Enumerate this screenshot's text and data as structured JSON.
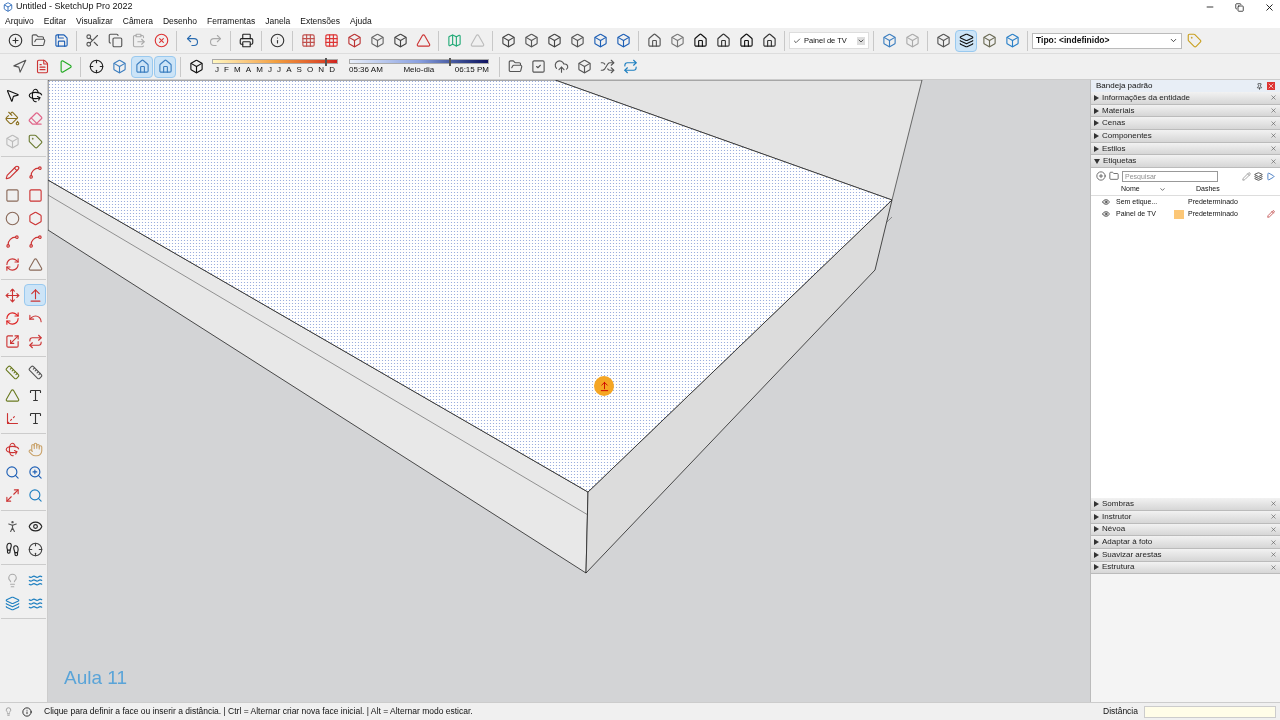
{
  "window": {
    "title": "Untitled - SketchUp Pro 2022"
  },
  "menu": [
    "Arquivo",
    "Editar",
    "Visualizar",
    "Câmera",
    "Desenho",
    "Ferramentas",
    "Janela",
    "Extensões",
    "Ajuda"
  ],
  "tag_dropdown": {
    "value": "Painel de TV",
    "checked": true
  },
  "style_buttons": [
    {
      "selected": false
    },
    {
      "selected": false
    },
    {
      "selected": false
    },
    {
      "selected": true
    },
    {
      "selected": false
    }
  ],
  "type_dropdown": {
    "value": "Tipo: <indefinido>"
  },
  "camera_buttons": [
    {
      "selected": false
    },
    {
      "selected": false
    },
    {
      "selected": true
    },
    {
      "selected": true
    }
  ],
  "shadow_date": {
    "months": [
      "J",
      "F",
      "M",
      "A",
      "M",
      "J",
      "J",
      "A",
      "S",
      "O",
      "N",
      "D"
    ],
    "level": 0.9
  },
  "shadow_time": {
    "start": "05:36 AM",
    "middle": "Meio-dia",
    "end": "06:15 PM",
    "level": 0.72
  },
  "left_tools": [
    {
      "selected": false
    },
    {
      "selected": false
    },
    {
      "selected": false
    },
    {
      "selected": false
    },
    {
      "selected": false
    },
    {
      "selected": false
    },
    {
      "selected": false
    },
    {
      "selected": false
    },
    {
      "selected": false
    },
    {
      "selected": false
    },
    {
      "selected": false
    },
    {
      "selected": false
    },
    {
      "selected": false
    },
    {
      "selected": false
    },
    {
      "selected": false
    },
    {
      "selected": false
    },
    {
      "selected": false
    },
    {
      "selected": true
    },
    {
      "selected": false
    },
    {
      "selected": false
    },
    {
      "selected": false
    },
    {
      "selected": false
    },
    {
      "selected": false
    },
    {
      "selected": false
    },
    {
      "selected": false
    },
    {
      "selected": false
    },
    {
      "selected": false
    },
    {
      "selected": false
    },
    {
      "selected": false
    },
    {
      "selected": false
    },
    {
      "selected": false
    },
    {
      "selected": false
    },
    {
      "selected": false
    },
    {
      "selected": false
    },
    {
      "selected": false
    },
    {
      "selected": false
    },
    {
      "selected": false
    },
    {
      "selected": false
    },
    {
      "selected": false
    },
    {
      "selected": false
    },
    {
      "selected": false
    },
    {
      "selected": false
    }
  ],
  "overlay_text": "Aula 11",
  "tray": {
    "title": "Bandeja padrão",
    "sections_top": [
      {
        "label": "Informações da entidade",
        "expanded": false
      },
      {
        "label": "Materiais",
        "expanded": false
      },
      {
        "label": "Cenas",
        "expanded": false
      },
      {
        "label": "Componentes",
        "expanded": false
      },
      {
        "label": "Estilos",
        "expanded": false
      },
      {
        "label": "Etiquetas",
        "expanded": true
      }
    ],
    "tags": {
      "search_placeholder": "Pesquisar",
      "columns": [
        "Nome",
        "Dashes"
      ],
      "rows": [
        {
          "name": "Sem etique...",
          "dashes": "Predeterminado",
          "color": null,
          "editing": false
        },
        {
          "name": "Painel de TV",
          "dashes": "Predeterminado",
          "color": "#fcc777",
          "editing": true
        }
      ]
    },
    "sections_bottom": [
      {
        "label": "Sombras",
        "expanded": false
      },
      {
        "label": "Instrutor",
        "expanded": false
      },
      {
        "label": "Névoa",
        "expanded": false
      },
      {
        "label": "Adaptar à foto",
        "expanded": false
      },
      {
        "label": "Suavizar arestas",
        "expanded": false
      },
      {
        "label": "Estrutura",
        "expanded": false
      }
    ]
  },
  "status_bar": {
    "message": "Clique para definir a face ou inserir a distância. | Ctrl = Alternar criar nova face inicial. | Alt = Alternar modo esticar.",
    "measure_label": "Distância"
  }
}
